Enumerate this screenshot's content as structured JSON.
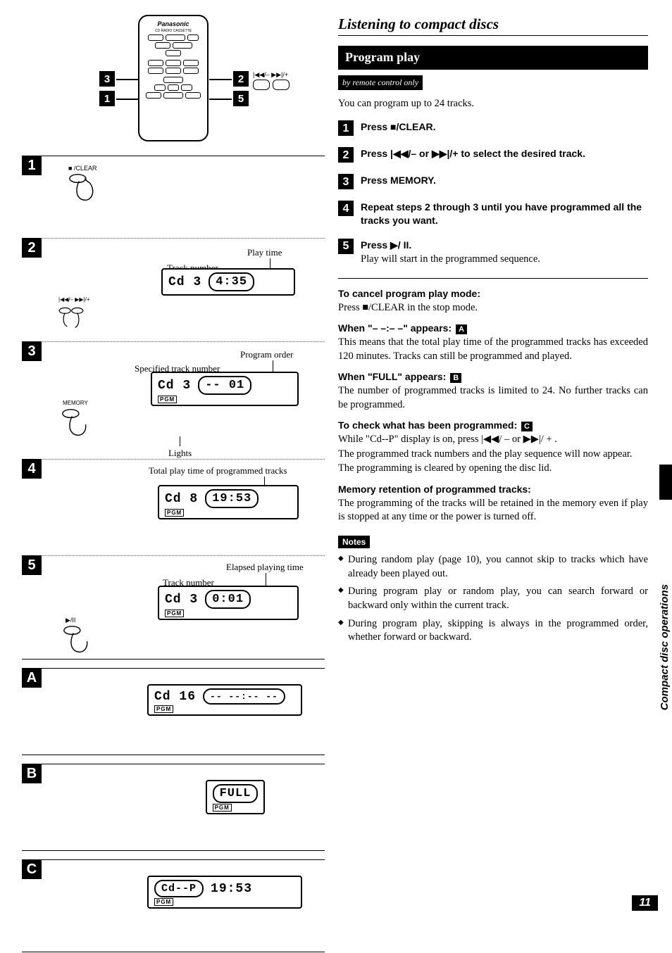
{
  "page_title": "Listening to compact discs",
  "program_play": "Program play",
  "remote_only": "by remote control only",
  "intro": "You can program up to 24 tracks.",
  "steps": [
    {
      "n": "1",
      "main": "Press ■/CLEAR."
    },
    {
      "n": "2",
      "main": "Press |◀◀/– or ▶▶|/+ to select the desired track."
    },
    {
      "n": "3",
      "main": "Press MEMORY."
    },
    {
      "n": "4",
      "main": "Repeat steps 2 through 3 until you have programmed all the tracks you want."
    },
    {
      "n": "5",
      "main": "Press ▶/ II.",
      "sub": "Play will start in the programmed sequence."
    }
  ],
  "cancel_head": "To cancel program play mode:",
  "cancel_body": "Press ■/CLEAR in the stop mode.",
  "dash_head": "When \"– –:– –\" appears:",
  "dash_ref": "A",
  "dash_body": "This means that the total play time of the programmed tracks has exceeded 120 minutes. Tracks can still be programmed and played.",
  "full_head": "When \"FULL\" appears:",
  "full_ref": "B",
  "full_body": "The number of programmed tracks is limited to 24. No further tracks can be programmed.",
  "check_head": "To check what has been programmed:",
  "check_ref": "C",
  "check_body1": "While \"Cd--P\" display is on, press |◀◀/ – or ▶▶|/ + .",
  "check_body2": "The programmed track numbers and the play sequence will now appear.",
  "check_body3": "The programming is cleared by opening the disc lid.",
  "mem_head": "Memory retention of programmed tracks:",
  "mem_body": "The programming of the tracks will be retained in the memory even if play is stopped at any time or the power is turned off.",
  "notes_label": "Notes",
  "notes": [
    "During random play (page 10), you cannot skip to tracks which have already been played out.",
    "During program play or random play, you can search forward or backward only within the current track.",
    "During program play, skipping is always in the programmed order, whether forward or backward."
  ],
  "side_label": "Compact disc operations",
  "page_number": "11",
  "remote_brand": "Panasonic",
  "remote_sub": "CD RADIO CASSETTE",
  "callouts": {
    "c1": "1",
    "c2": "2",
    "c3": "3",
    "c5": "5"
  },
  "skip_icons": "|◀◀/–   ▶▶|/+",
  "panels": {
    "p1": {
      "n": "1",
      "btn": "■ /CLEAR"
    },
    "p2": {
      "n": "2",
      "lbl_track": "Track number",
      "lbl_time": "Play time",
      "lcd_left": "Cd  3",
      "lcd_right": "4:35",
      "btns": "|◀◀/–  ▶▶|/+"
    },
    "p3": {
      "n": "3",
      "lbl_spec": "Specified track number",
      "lbl_order": "Program order",
      "btn": "MEMORY",
      "lcd_left": "Cd  3",
      "lcd_right": "-- 01",
      "pgm": "PGM",
      "lbl_lights": "Lights"
    },
    "p4": {
      "n": "4",
      "lbl_total": "Total play time of programmed tracks",
      "lcd_left": "Cd  8",
      "lcd_right": "19:53",
      "pgm": "PGM"
    },
    "p5": {
      "n": "5",
      "lbl_track": "Track number",
      "lbl_elapsed": "Elapsed playing time",
      "btn": "▶/II",
      "lcd_left": "Cd  3",
      "lcd_right": "0:01",
      "pgm": "PGM"
    },
    "pA": {
      "n": "A",
      "lcd_left": "Cd 16",
      "lcd_right": "-- --:-- --",
      "pgm": "PGM"
    },
    "pB": {
      "n": "B",
      "lcd": "FULL",
      "pgm": "PGM"
    },
    "pC": {
      "n": "C",
      "lcd_left": "Cd--P",
      "lcd_right": "19:53",
      "pgm": "PGM"
    }
  }
}
